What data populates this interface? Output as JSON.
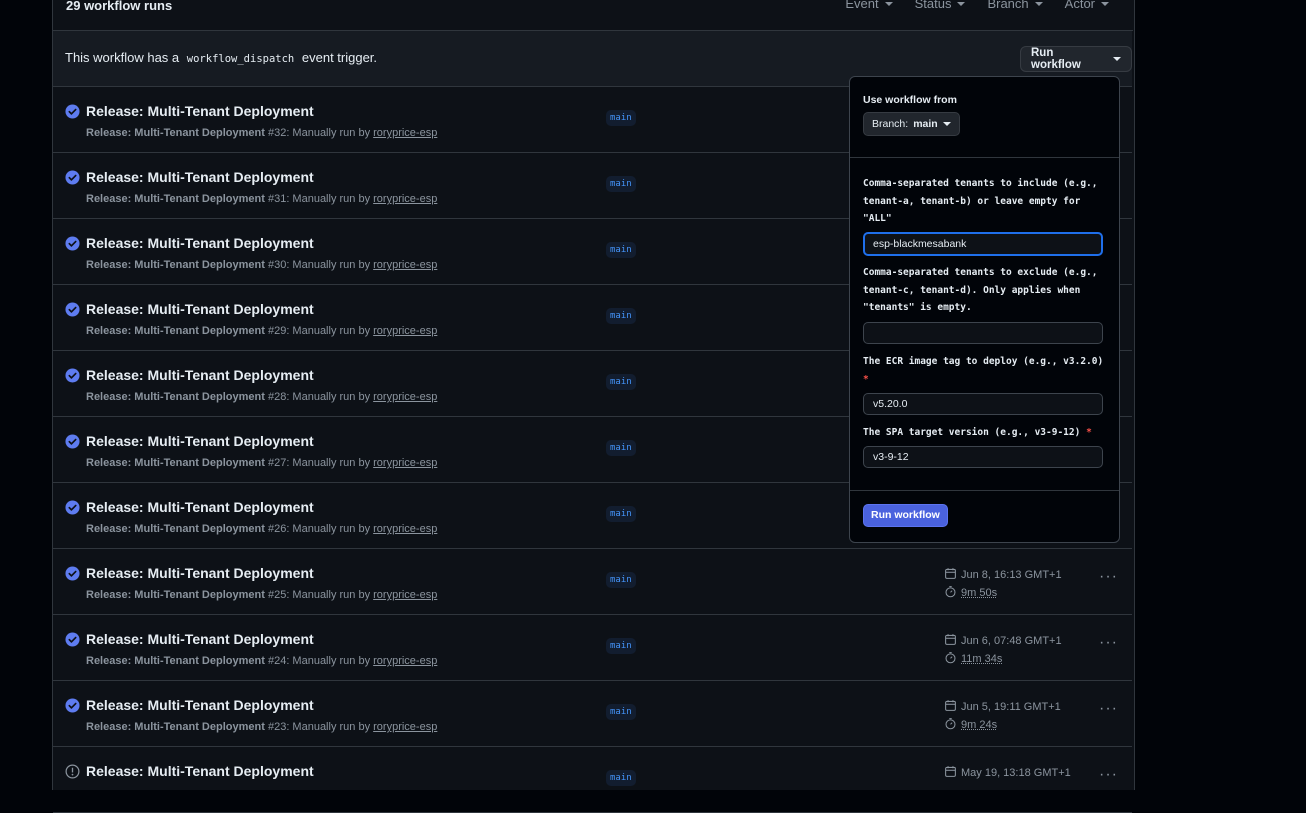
{
  "header": {
    "run_count": "29 workflow runs",
    "filters": [
      "Event",
      "Status",
      "Branch",
      "Actor"
    ]
  },
  "dispatch": {
    "text_before": "This workflow has a",
    "code": "workflow_dispatch",
    "text_after": "event trigger.",
    "run_button": "Run workflow"
  },
  "popup": {
    "use_from": "Use workflow from",
    "branch_prefix": "Branch:",
    "branch_value": "main",
    "fields": [
      {
        "label": "Comma-separated tenants to include (e.g., tenant-a, tenant-b) or leave empty for \"ALL\"",
        "required": "",
        "value": "esp-blackmesabank"
      },
      {
        "label": "Comma-separated tenants to exclude (e.g., tenant-c, tenant-d). Only applies when \"tenants\" is empty.",
        "required": "",
        "value": ""
      },
      {
        "label": "The ECR image tag to deploy (e.g., v3.2.0)",
        "required": "*",
        "value": "v5.20.0"
      },
      {
        "label": "The SPA target version (e.g., v3-9-12)",
        "required": "*",
        "value": "v3-9-12"
      }
    ],
    "submit": "Run workflow"
  },
  "runs": [
    {
      "title": "Release: Multi-Tenant Deployment",
      "workflow": "Release: Multi-Tenant Deployment",
      "number": "#32",
      "trigger": ": Manually run by",
      "actor": "roryprice-esp",
      "branch": "main",
      "status": "success",
      "date": "",
      "duration": ""
    },
    {
      "title": "Release: Multi-Tenant Deployment",
      "workflow": "Release: Multi-Tenant Deployment",
      "number": "#31",
      "trigger": ": Manually run by",
      "actor": "roryprice-esp",
      "branch": "main",
      "status": "success",
      "date": "",
      "duration": ""
    },
    {
      "title": "Release: Multi-Tenant Deployment",
      "workflow": "Release: Multi-Tenant Deployment",
      "number": "#30",
      "trigger": ": Manually run by",
      "actor": "roryprice-esp",
      "branch": "main",
      "status": "success",
      "date": "",
      "duration": ""
    },
    {
      "title": "Release: Multi-Tenant Deployment",
      "workflow": "Release: Multi-Tenant Deployment",
      "number": "#29",
      "trigger": ": Manually run by",
      "actor": "roryprice-esp",
      "branch": "main",
      "status": "success",
      "date": "",
      "duration": ""
    },
    {
      "title": "Release: Multi-Tenant Deployment",
      "workflow": "Release: Multi-Tenant Deployment",
      "number": "#28",
      "trigger": ": Manually run by",
      "actor": "roryprice-esp",
      "branch": "main",
      "status": "success",
      "date": "",
      "duration": ""
    },
    {
      "title": "Release: Multi-Tenant Deployment",
      "workflow": "Release: Multi-Tenant Deployment",
      "number": "#27",
      "trigger": ": Manually run by",
      "actor": "roryprice-esp",
      "branch": "main",
      "status": "success",
      "date": "",
      "duration": ""
    },
    {
      "title": "Release: Multi-Tenant Deployment",
      "workflow": "Release: Multi-Tenant Deployment",
      "number": "#26",
      "trigger": ": Manually run by",
      "actor": "roryprice-esp",
      "branch": "main",
      "status": "success",
      "date": "",
      "duration": ""
    },
    {
      "title": "Release: Multi-Tenant Deployment",
      "workflow": "Release: Multi-Tenant Deployment",
      "number": "#25",
      "trigger": ": Manually run by",
      "actor": "roryprice-esp",
      "branch": "main",
      "status": "success",
      "date": "Jun 8, 16:13 GMT+1",
      "duration": "9m 50s"
    },
    {
      "title": "Release: Multi-Tenant Deployment",
      "workflow": "Release: Multi-Tenant Deployment",
      "number": "#24",
      "trigger": ": Manually run by",
      "actor": "roryprice-esp",
      "branch": "main",
      "status": "success",
      "date": "Jun 6, 07:48 GMT+1",
      "duration": "11m 34s"
    },
    {
      "title": "Release: Multi-Tenant Deployment",
      "workflow": "Release: Multi-Tenant Deployment",
      "number": "#23",
      "trigger": ": Manually run by",
      "actor": "roryprice-esp",
      "branch": "main",
      "status": "success",
      "date": "Jun 5, 19:11 GMT+1",
      "duration": "9m 24s"
    },
    {
      "title": "Release: Multi-Tenant Deployment",
      "workflow": "",
      "number": "",
      "trigger": "",
      "actor": "",
      "branch": "main",
      "status": "warning",
      "date": "May 19, 13:18 GMT+1",
      "duration": ""
    }
  ],
  "colors": {
    "success": "#5e7cf0",
    "warning": "#8b949e",
    "accent": "#4a62de"
  }
}
